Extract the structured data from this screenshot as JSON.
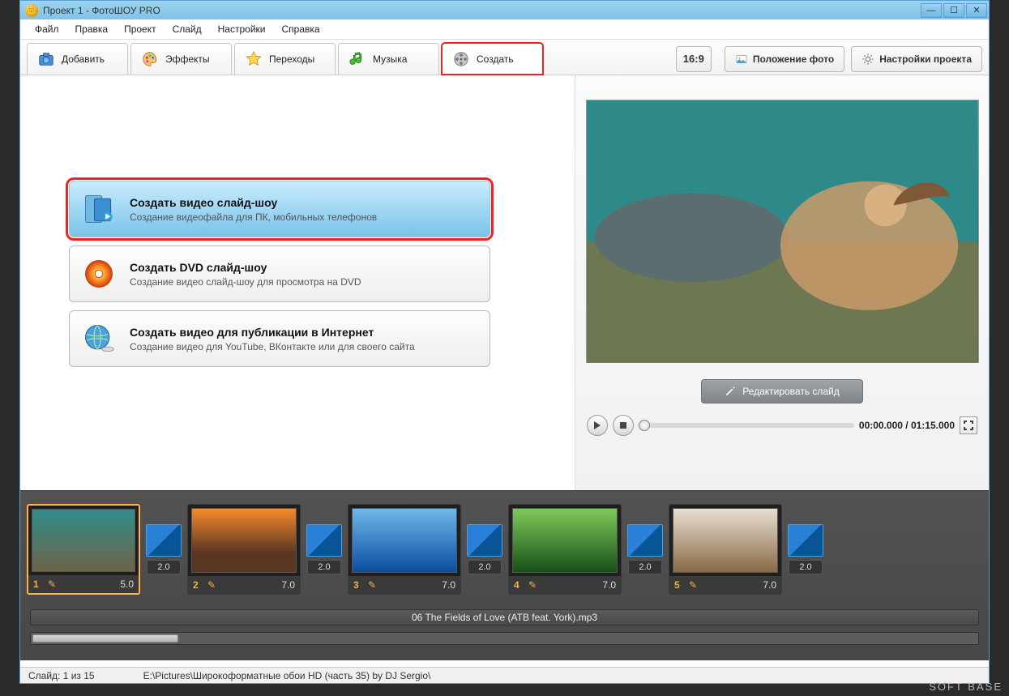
{
  "window": {
    "title": "Проект 1 - ФотоШОУ PRO"
  },
  "menu": {
    "file": "Файл",
    "edit": "Правка",
    "project": "Проект",
    "slide": "Слайд",
    "settings": "Настройки",
    "help": "Справка"
  },
  "tabs": {
    "add": "Добавить",
    "effects": "Эффекты",
    "transitions": "Переходы",
    "music": "Музыка",
    "create": "Создать"
  },
  "right_toolbar": {
    "aspect": "16:9",
    "photo_pos": "Положение фото",
    "proj_settings": "Настройки проекта"
  },
  "create_options": [
    {
      "title": "Создать видео слайд-шоу",
      "desc": "Создание видеофайла для ПК, мобильных телефонов"
    },
    {
      "title": "Создать DVD слайд-шоу",
      "desc": "Создание видео слайд-шоу для просмотра на DVD"
    },
    {
      "title": "Создать видео для публикации в Интернет",
      "desc": "Создание видео для YouTube, ВКонтакте или для своего сайта"
    }
  ],
  "preview": {
    "edit_btn": "Редактировать слайд",
    "time": "00:00.000 / 01:15.000"
  },
  "timeline": {
    "slides": [
      {
        "num": "1",
        "dur": "5.0"
      },
      {
        "num": "2",
        "dur": "7.0"
      },
      {
        "num": "3",
        "dur": "7.0"
      },
      {
        "num": "4",
        "dur": "7.0"
      },
      {
        "num": "5",
        "dur": "7.0"
      }
    ],
    "trans": [
      "2.0",
      "2.0",
      "2.0",
      "2.0",
      "2.0"
    ],
    "audio": "06 The Fields of Love (ATB feat. York).mp3"
  },
  "status": {
    "slide": "Слайд: 1 из 15",
    "path": "E:\\Pictures\\Широкоформатные обои HD (часть 35) by DJ Sergio\\"
  },
  "watermark": "SOFT BASE"
}
